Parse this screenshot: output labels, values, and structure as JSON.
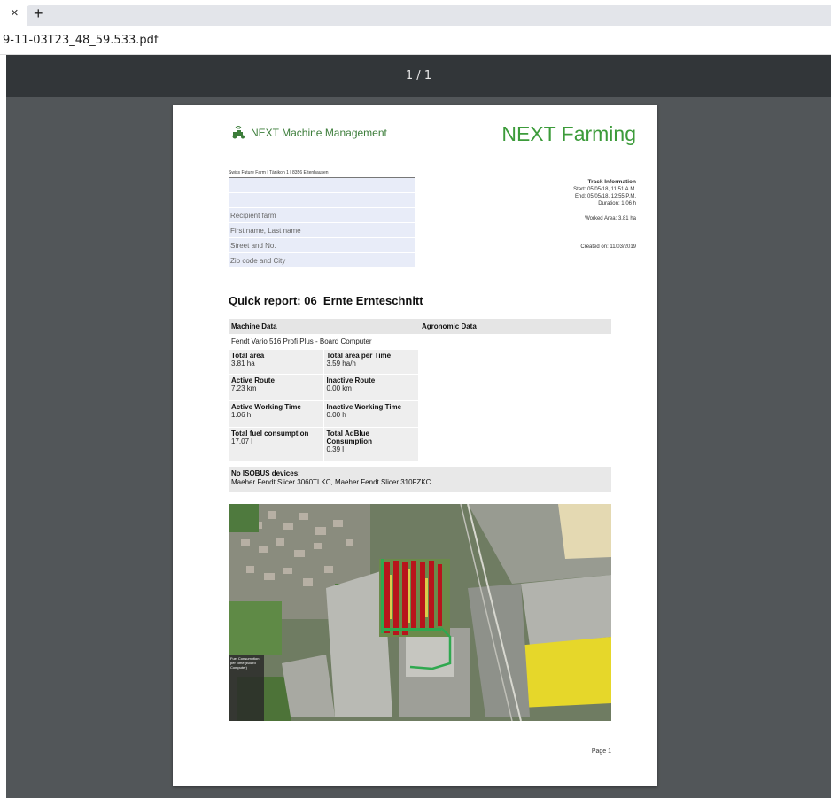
{
  "browser": {
    "tab_close": "×",
    "tab_new": "+",
    "filename": "9-11-03T23_48_59.533.pdf"
  },
  "viewer": {
    "page_indicator": "1 / 1"
  },
  "pdf": {
    "logo_left_text": "NEXT Machine Management",
    "logo_right_text": "NEXT Farming",
    "sender_line": "Swiss Future Farm | Tänikon 1 | 8356 Ettenhausen",
    "address_rows": [
      "",
      "",
      "Recipient farm",
      "First name, Last name",
      "Street and No.",
      "Zip code and City"
    ],
    "track": {
      "title": "Track Information",
      "start": "Start: 05/05/18, 11:51 A.M.",
      "end": "End: 05/05/18, 12:55 P.M.",
      "duration": "Duration: 1.06 h",
      "worked_area": "Worked Area: 3.81 ha",
      "created": "Created on: 11/03/2019"
    },
    "report_title": "Quick report: 06_Ernte Ernteschnitt",
    "headers": {
      "machine": "Machine Data",
      "agronomic": "Agronomic Data"
    },
    "machine_name": "Fendt Vario 516 Profi Plus - Board Computer",
    "pairs": [
      [
        {
          "label": "Total area",
          "value": "3.81 ha"
        },
        {
          "label": "Total area per Time",
          "value": "3.59 ha/h"
        }
      ],
      [
        {
          "label": "Active Route",
          "value": "7.23 km"
        },
        {
          "label": "Inactive Route",
          "value": "0.00 km"
        }
      ],
      [
        {
          "label": "Active Working Time",
          "value": "1.06 h"
        },
        {
          "label": "Inactive Working Time",
          "value": "0.00 h"
        }
      ],
      [
        {
          "label": "Total fuel consumption",
          "value": "17.07 l"
        },
        {
          "label": "Total AdBlue Consumption",
          "value": "0.39 l"
        }
      ]
    ],
    "isobus": {
      "title": "No ISOBUS devices:",
      "devices": "Maeher Fendt Slicer 3060TLKC, Maeher Fendt Slicer 310FZKC"
    },
    "map_legend": "Fuel Consumption per Time (Board Computer)",
    "footer": "Page 1",
    "colors": {
      "brand_green": "#3c9b3a",
      "field_yellow": "#e6d72a",
      "track_red": "#b8141b"
    }
  }
}
